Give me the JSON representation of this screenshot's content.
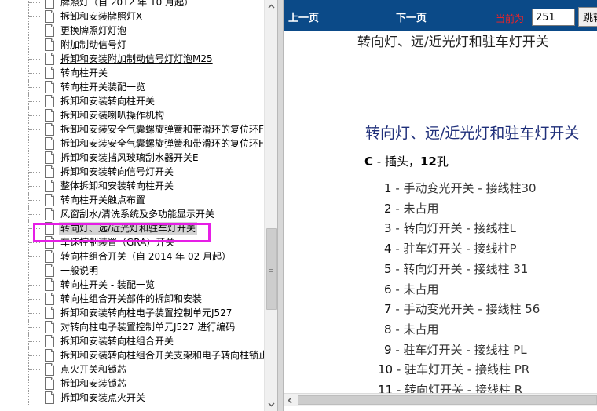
{
  "tree": {
    "items": [
      {
        "label": "牌照灯（自 2012 年 10 月起）",
        "link": false
      },
      {
        "label": "拆卸和安装牌照灯X",
        "link": false
      },
      {
        "label": "更换牌照灯灯泡",
        "link": false
      },
      {
        "label": "附加制动信号灯",
        "link": false
      },
      {
        "label": "拆卸和安装附加制动信号灯灯泡M25",
        "link": true
      },
      {
        "label": "转向柱开关",
        "link": false
      },
      {
        "label": "转向柱开关装配一览",
        "link": false
      },
      {
        "label": "拆卸和安装转向柱开关",
        "link": false
      },
      {
        "label": "拆卸和安装喇叭操作机构",
        "link": false
      },
      {
        "label": "拆卸和安装安全气囊螺旋弹簧和带滑环的复位环F",
        "link": false
      },
      {
        "label": "拆卸和安装安全气囊螺旋弹簧和带滑环的复位环F",
        "link": false
      },
      {
        "label": "拆卸和安装挡风玻璃刮水器开关E",
        "link": false
      },
      {
        "label": "拆卸和安装转向信号灯开关",
        "link": false
      },
      {
        "label": "整体拆卸和安装转向柱开关",
        "link": false
      },
      {
        "label": "转向柱开关触点布置",
        "link": false
      },
      {
        "label": "风窗刮水/清洗系统及多功能显示开关",
        "link": false
      },
      {
        "label": "转向灯、远/近光灯和驻车灯开关",
        "link": false
      },
      {
        "label": "车速控制装置（GRA）开关",
        "link": false
      },
      {
        "label": "转向柱组合开关（自 2014 年 02 月起）",
        "link": false
      },
      {
        "label": "一般说明",
        "link": false
      },
      {
        "label": "转向柱开关 - 装配一览",
        "link": false
      },
      {
        "label": "转向柱组合开关部件的拆卸和安装",
        "link": false
      },
      {
        "label": "拆卸和安装转向柱电子装置控制单元J527",
        "link": false
      },
      {
        "label": "对转向柱电子装置控制单元J527 进行编码",
        "link": false
      },
      {
        "label": "拆卸和安装转向柱组合开关",
        "link": false
      },
      {
        "label": "拆卸和安装转向柱组合开关支架和电子转向柱锁止",
        "link": false
      },
      {
        "label": "点火开关和锁芯",
        "link": false
      },
      {
        "label": "拆卸和安装锁芯",
        "link": false
      },
      {
        "label": "拆卸和安装点火开关",
        "link": false
      }
    ],
    "selected_index": 16
  },
  "nav": {
    "prev_label": "上一页",
    "next_label": "下一页",
    "current_label": "当前为",
    "page_value": "251",
    "jump_label": "跳转"
  },
  "document": {
    "header": "转向灯、远/近光灯和驻车灯开关",
    "title": "转向灯、远/近光灯和驻车灯开关",
    "connector_letter": "C",
    "connector_desc": " - 插头，",
    "connector_count": "12",
    "connector_unit": "孔",
    "pins": [
      {
        "num": "1",
        "desc": " - 手动变光开关 - 接线柱30"
      },
      {
        "num": "2",
        "desc": " - 未占用"
      },
      {
        "num": "3",
        "desc": " - 转向灯开关 - 接线柱L"
      },
      {
        "num": "4",
        "desc": " - 驻车灯开关 - 接线柱P"
      },
      {
        "num": "5",
        "desc": " - 转向灯开关 - 接线柱 31"
      },
      {
        "num": "6",
        "desc": " - 未占用"
      },
      {
        "num": "7",
        "desc": " - 手动变光开关 - 接线柱 56"
      },
      {
        "num": "8",
        "desc": " - 未占用"
      },
      {
        "num": "9",
        "desc": " - 驻车灯开关 - 接线柱 PL"
      },
      {
        "num": "10",
        "desc": " - 驻车灯开关 - 接线柱 PR"
      },
      {
        "num": "11",
        "desc": " - 转向灯开关 - 接线柱 R"
      }
    ]
  },
  "colors": {
    "nav_bar": "#0b4a88",
    "highlight_border": "#e61ee6",
    "current_label": "#ff1f1f",
    "title": "#1f2f7a"
  },
  "icons": {
    "tree_item": "document-icon",
    "scroll_up": "up-arrow-icon",
    "scroll_down": "down-arrow-icon",
    "scroll_left": "left-arrow-icon"
  }
}
